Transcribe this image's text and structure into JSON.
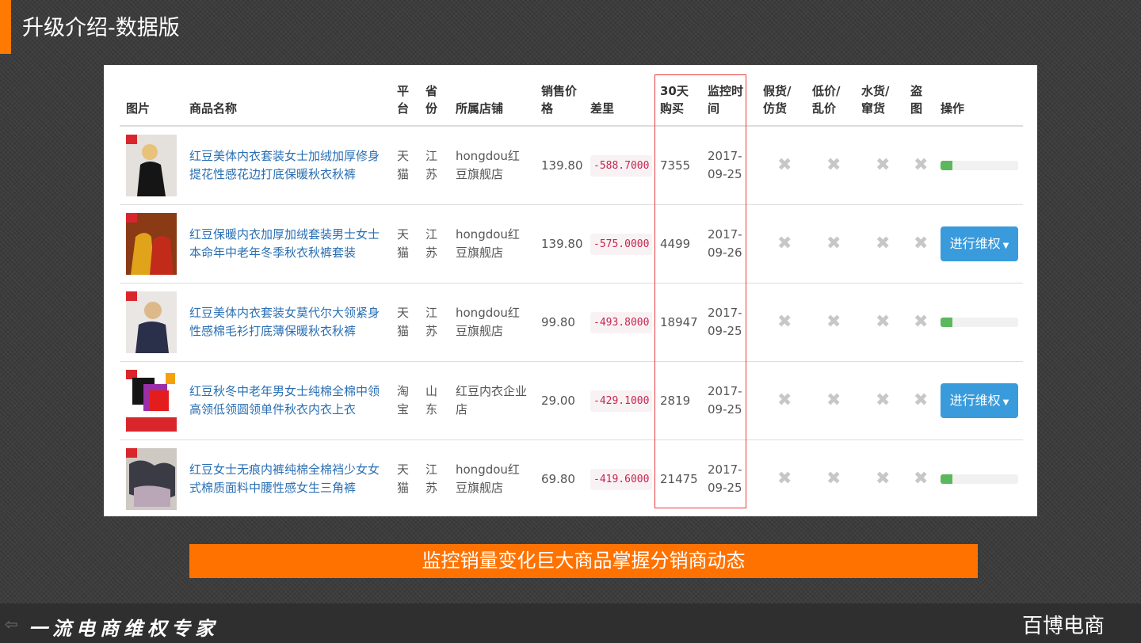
{
  "slide": {
    "title": "升级介绍-数据版",
    "banner": "监控销量变化巨大商品掌握分销商动态",
    "footer_slogan": "一流电商维权专家",
    "footer_brand": "百博电商",
    "accent_color": "#ff7a00",
    "highlight_color": "#e83a3a"
  },
  "table": {
    "headers": {
      "image": "图片",
      "name": "商品名称",
      "platform": "平台",
      "province": "省份",
      "store": "所属店铺",
      "price": "销售价格",
      "diff": "差里",
      "sales30": "30天购买",
      "monitor_time": "监控时间",
      "fake": "假货/仿货",
      "lowprice": "低价/乱价",
      "grey": "水货/窜货",
      "piracy": "盗图",
      "action": "操作"
    },
    "rows": [
      {
        "name": "红豆美体内衣套装女士加绒加厚修身提花性感花边打底保暖秋衣秋裤",
        "platform": "天猫",
        "province": "江苏",
        "store": "hongdou红豆旗舰店",
        "price": "139.80",
        "diff": "-588.7000",
        "sales30": "7355",
        "monitor_time": "2017-09-25",
        "fake": "✖",
        "lowprice": "✖",
        "grey": "✖",
        "piracy": "✖",
        "action_type": "progress",
        "progress_fraction": 0.15
      },
      {
        "name": "红豆保暖内衣加厚加绒套装男士女士本命年中老年冬季秋衣秋裤套装",
        "platform": "天猫",
        "province": "江苏",
        "store": "hongdou红豆旗舰店",
        "price": "139.80",
        "diff": "-575.0000",
        "sales30": "4499",
        "monitor_time": "2017-09-26",
        "fake": "✖",
        "lowprice": "✖",
        "grey": "✖",
        "piracy": "✖",
        "action_type": "button",
        "action_label": "进行维权"
      },
      {
        "name": "红豆美体内衣套装女莫代尔大领紧身性感棉毛衫打底薄保暖秋衣秋裤",
        "platform": "天猫",
        "province": "江苏",
        "store": "hongdou红豆旗舰店",
        "price": "99.80",
        "diff": "-493.8000",
        "sales30": "18947",
        "monitor_time": "2017-09-25",
        "fake": "✖",
        "lowprice": "✖",
        "grey": "✖",
        "piracy": "✖",
        "action_type": "progress",
        "progress_fraction": 0.15
      },
      {
        "name": "红豆秋冬中老年男女士纯棉全棉中领高领低领圆领单件秋衣内衣上衣",
        "platform": "淘宝",
        "province": "山东",
        "store": "红豆内衣企业店",
        "price": "29.00",
        "diff": "-429.1000",
        "sales30": "2819",
        "monitor_time": "2017-09-25",
        "fake": "✖",
        "lowprice": "✖",
        "grey": "✖",
        "piracy": "✖",
        "action_type": "button",
        "action_label": "进行维权"
      },
      {
        "name": "红豆女士无痕内裤纯棉全棉裆少女女式棉质面料中腰性感女生三角裤",
        "platform": "天猫",
        "province": "江苏",
        "store": "hongdou红豆旗舰店",
        "price": "69.80",
        "diff": "-419.6000",
        "sales30": "21475",
        "monitor_time": "2017-09-25",
        "fake": "✖",
        "lowprice": "✖",
        "grey": "✖",
        "piracy": "✖",
        "action_type": "progress",
        "progress_fraction": 0.15
      }
    ]
  }
}
